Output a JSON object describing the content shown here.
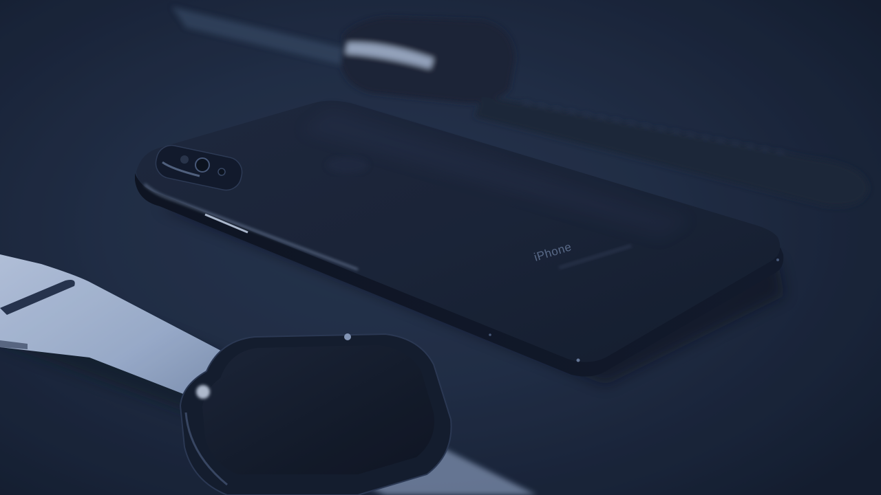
{
  "phone": {
    "brand_text": "iPhone"
  },
  "colors": {
    "background": "#243148",
    "phone_body": "#1a2233",
    "light_band": "#b8c5db",
    "dark_band": "#1d2535"
  }
}
